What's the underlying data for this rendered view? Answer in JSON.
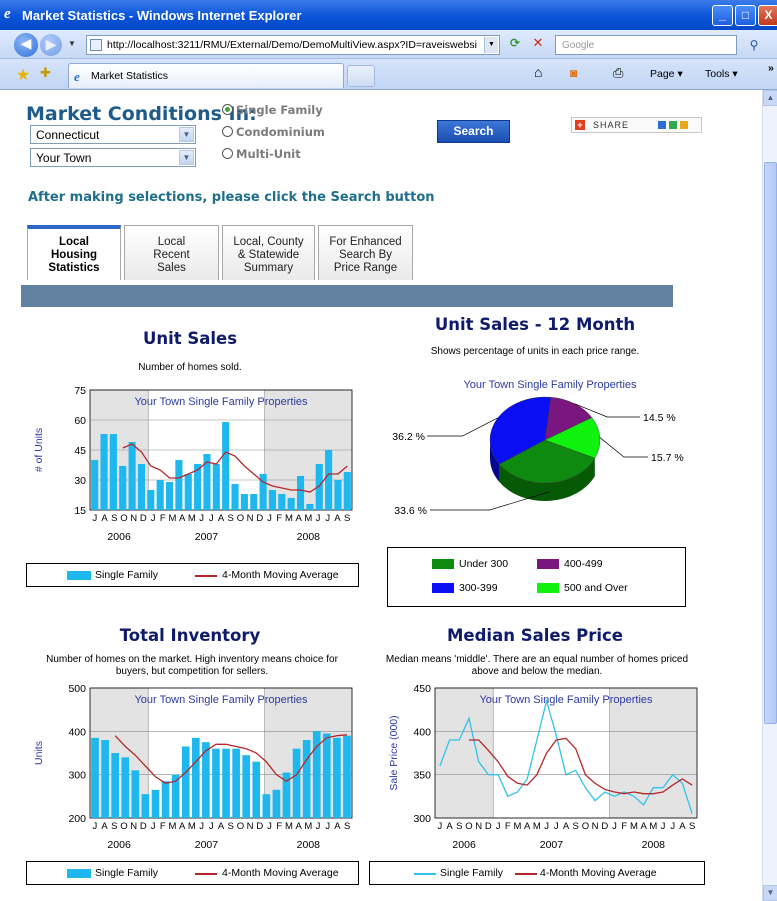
{
  "window": {
    "title": "Market Statistics - Windows Internet Explorer",
    "minimize": "_",
    "maximize": "□",
    "close": "X"
  },
  "address_bar": {
    "url": "http://localhost:3211/RMU/External/Demo/DemoMultiView.aspx?ID=raveiswebsite&",
    "search_placeholder": "Google"
  },
  "tabs_bar": {
    "tab_title": "Market Statistics",
    "page_label": "Page ▾",
    "tools_label": "Tools ▾",
    "more": "»"
  },
  "form": {
    "heading": "Market Conditions In:",
    "state_value": "Connecticut",
    "town_value": "Your Town",
    "property_types": [
      "Single Family",
      "Condominium",
      "Multi-Unit"
    ],
    "selected_type": "Single Family",
    "search_label": "Search",
    "share_label": "SHARE",
    "hint": "After making selections, please click the Search button"
  },
  "page_tabs": [
    {
      "line1": "Local",
      "line2": "Housing",
      "line3": "Statistics"
    },
    {
      "line1": "Local",
      "line2": "Recent",
      "line3": "Sales"
    },
    {
      "line1": "Local, County",
      "line2": "& Statewide",
      "line3": "Summary"
    },
    {
      "line1": "For Enhanced",
      "line2": "Search By",
      "line3": "Price Range"
    }
  ],
  "colors": {
    "bar": "#1fb8ee",
    "avg_line": "#b5272b",
    "line": "#33c1ee",
    "title": "#0e1a6b",
    "plot_bg_shade": "#e3e3e3",
    "pie": [
      "#0e8a0e",
      "#7a1680",
      "#0a0ef2",
      "#0ef20e"
    ]
  },
  "month_letters": [
    "J",
    "A",
    "S",
    "O",
    "N",
    "D",
    "J",
    "F",
    "M",
    "A",
    "M",
    "J",
    "J",
    "A",
    "S",
    "O",
    "N",
    "D",
    "J",
    "F",
    "M",
    "A",
    "M",
    "J",
    "J",
    "A",
    "S"
  ],
  "chart_data": [
    {
      "type": "bar",
      "title": "Unit Sales",
      "subtitle": "Number of homes sold.",
      "inner_title": "Your Town Single Family Properties",
      "ylabel": "# of Units",
      "ylim": [
        15,
        75
      ],
      "yticks": [
        15,
        30,
        45,
        60,
        75
      ],
      "years": [
        "2006",
        "2007",
        "2008"
      ],
      "series": [
        {
          "name": "Single Family",
          "kind": "bar",
          "values": [
            40,
            53,
            53,
            37,
            49,
            38,
            25,
            30,
            29,
            40,
            33,
            38,
            43,
            38,
            59,
            28,
            23,
            23,
            33,
            25,
            23,
            21,
            32,
            18,
            38,
            45,
            30,
            34
          ]
        },
        {
          "name": "4-Month Moving Average",
          "kind": "line",
          "values": [
            null,
            null,
            null,
            46,
            48,
            44,
            37,
            35,
            31,
            31,
            33,
            35,
            39,
            38,
            44,
            42,
            37,
            33,
            29,
            27,
            26,
            25,
            25,
            24,
            27,
            33,
            33,
            37
          ]
        }
      ]
    },
    {
      "type": "pie",
      "title": "Unit Sales - 12 Month",
      "subtitle": "Shows percentage of units in each price range.",
      "inner_title": "Your Town Single Family Properties",
      "slices": [
        {
          "name": "Under 300",
          "value": 33.6,
          "label": "33.6 %"
        },
        {
          "name": "400-499",
          "value": 14.5,
          "label": "14.5 %"
        },
        {
          "name": "300-399",
          "value": 36.2,
          "label": "36.2 %"
        },
        {
          "name": "500 and Over",
          "value": 15.7,
          "label": "15.7 %"
        }
      ]
    },
    {
      "type": "bar",
      "title": "Total Inventory",
      "subtitle": "Number of homes on the market. High inventory means choice for buyers, but competition for sellers.",
      "inner_title": "Your Town Single Family Properties",
      "ylabel": "Units",
      "ylim": [
        200,
        500
      ],
      "yticks": [
        200,
        300,
        400,
        500
      ],
      "years": [
        "2006",
        "2007",
        "2008"
      ],
      "series": [
        {
          "name": "Single Family",
          "kind": "bar",
          "values": [
            385,
            380,
            350,
            340,
            310,
            255,
            265,
            285,
            300,
            365,
            385,
            375,
            360,
            360,
            360,
            345,
            330,
            255,
            265,
            305,
            360,
            380,
            400,
            395,
            385,
            390
          ]
        },
        {
          "name": "4-Month Moving Average",
          "kind": "line",
          "values": [
            null,
            null,
            390,
            365,
            345,
            320,
            295,
            280,
            285,
            305,
            330,
            355,
            370,
            370,
            365,
            360,
            350,
            330,
            300,
            285,
            300,
            335,
            365,
            385,
            390,
            392
          ]
        }
      ]
    },
    {
      "type": "line",
      "title": "Median Sales Price",
      "subtitle": "Median means 'middle'. There are an equal number of homes priced above and below the median.",
      "inner_title": "Your Town Single Family Properties",
      "ylabel": "Sale Price (000)",
      "ylim": [
        300,
        450
      ],
      "yticks": [
        300,
        350,
        400,
        450
      ],
      "years": [
        "2006",
        "2007",
        "2008"
      ],
      "series": [
        {
          "name": "Single Family",
          "kind": "line",
          "values": [
            360,
            390,
            390,
            415,
            365,
            350,
            350,
            325,
            330,
            345,
            390,
            435,
            395,
            350,
            355,
            335,
            320,
            330,
            325,
            330,
            325,
            315,
            335,
            335,
            350,
            340,
            305
          ]
        },
        {
          "name": "4-Month Moving Average",
          "kind": "line",
          "values": [
            null,
            null,
            null,
            390,
            390,
            378,
            365,
            348,
            340,
            338,
            350,
            375,
            390,
            392,
            380,
            350,
            340,
            333,
            330,
            328,
            330,
            328,
            328,
            330,
            338,
            345,
            338
          ]
        }
      ]
    }
  ]
}
